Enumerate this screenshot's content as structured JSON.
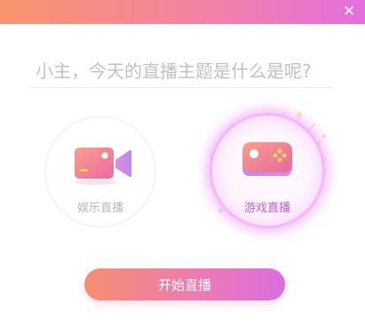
{
  "window": {
    "close_icon": "close-icon",
    "close_glyph": "✕"
  },
  "topic_input": {
    "placeholder": "小主，今天的直播主题是什么是呢?",
    "value": ""
  },
  "categories": [
    {
      "label": "娱乐直播",
      "icon": "video-camera-icon",
      "selected": false
    },
    {
      "label": "游戏直播",
      "icon": "gamepad-icon",
      "selected": true
    }
  ],
  "start_button": {
    "label": "开始直播"
  },
  "colors": {
    "gradient_start": "#f8956c",
    "gradient_mid": "#f383a3",
    "gradient_end": "#e36ee0",
    "selected_label": "#cd5cd8",
    "unselected_label": "#b9b9b9",
    "placeholder": "#c2c2c2"
  }
}
